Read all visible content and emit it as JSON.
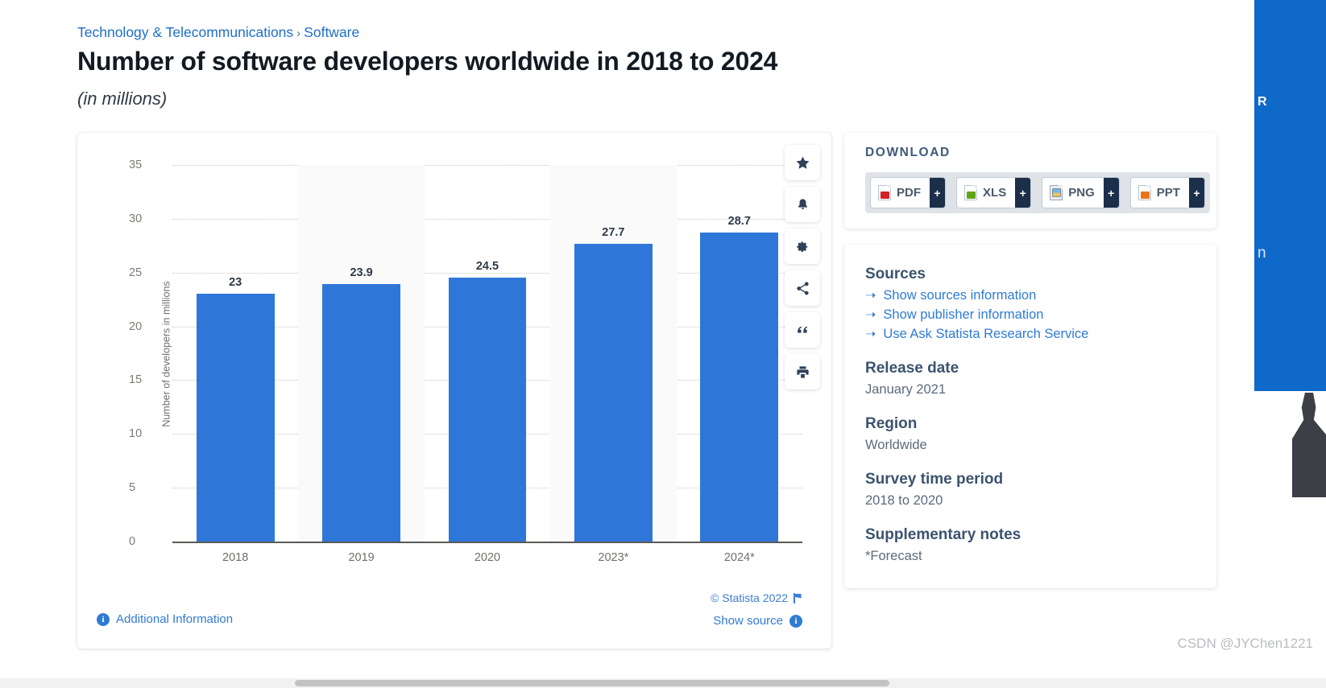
{
  "breadcrumb": {
    "items": [
      "Technology & Telecommunications",
      "Software"
    ],
    "separator": "›"
  },
  "header": {
    "title": "Number of software developers worldwide in 2018 to 2024",
    "subtitle": "(in millions)"
  },
  "chart_data": {
    "type": "bar",
    "title": "Number of software developers worldwide in 2018 to 2024",
    "subtitle": "(in millions)",
    "categories": [
      "2018",
      "2019",
      "2020",
      "2023*",
      "2024*"
    ],
    "values": [
      23,
      23.9,
      24.5,
      27.7,
      28.7
    ],
    "value_labels": [
      "23",
      "23.9",
      "24.5",
      "27.7",
      "28.7"
    ],
    "xlabel": "",
    "ylabel": "Number of developers in millions",
    "ylim": [
      0,
      35
    ],
    "yticks": [
      0,
      5,
      10,
      15,
      20,
      25,
      30,
      35
    ],
    "ytick_labels": [
      "0",
      "5",
      "10",
      "15",
      "20",
      "25",
      "30",
      "35"
    ],
    "grid": true,
    "legend": "none",
    "bar_color": "#2e77d8",
    "band_color": "#fafafa"
  },
  "chart_toolbar": {
    "buttons": [
      {
        "name": "star-icon",
        "label": "Add to favorites"
      },
      {
        "name": "bell-icon",
        "label": "Set alert"
      },
      {
        "name": "gear-icon",
        "label": "Settings"
      },
      {
        "name": "share-icon",
        "label": "Share"
      },
      {
        "name": "quote-icon",
        "label": "Citation"
      },
      {
        "name": "print-icon",
        "label": "Print"
      }
    ]
  },
  "chart_footer": {
    "additional_information": "Additional Information",
    "show_source": "Show source",
    "copyright": "© Statista 2022",
    "info_glyph": "i"
  },
  "download": {
    "title": "DOWNLOAD",
    "buttons": [
      {
        "label": "PDF",
        "type": "pdf",
        "plus": "+"
      },
      {
        "label": "XLS",
        "type": "xls",
        "plus": "+"
      },
      {
        "label": "PNG",
        "type": "png",
        "plus": "+"
      },
      {
        "label": "PPT",
        "type": "ppt",
        "plus": "+"
      }
    ]
  },
  "info": {
    "sources_heading": "Sources",
    "source_links": [
      "Show sources information",
      "Show publisher information",
      "Use Ask Statista Research Service"
    ],
    "arrow": "➝",
    "release_date_heading": "Release date",
    "release_date_value": "January 2021",
    "region_heading": "Region",
    "region_value": "Worldwide",
    "survey_heading": "Survey time period",
    "survey_value": "2018 to 2020",
    "notes_heading": "Supplementary notes",
    "notes_value": "*Forecast"
  },
  "promo": {
    "line1": "R",
    "line2": "n"
  },
  "watermark": "CSDN @JYChen1221",
  "colors": {
    "accent_blue": "#2e77d8",
    "link_blue": "#2f7bd4",
    "heading_navy": "#3b536f",
    "dark_chip": "#1c2f4a"
  }
}
